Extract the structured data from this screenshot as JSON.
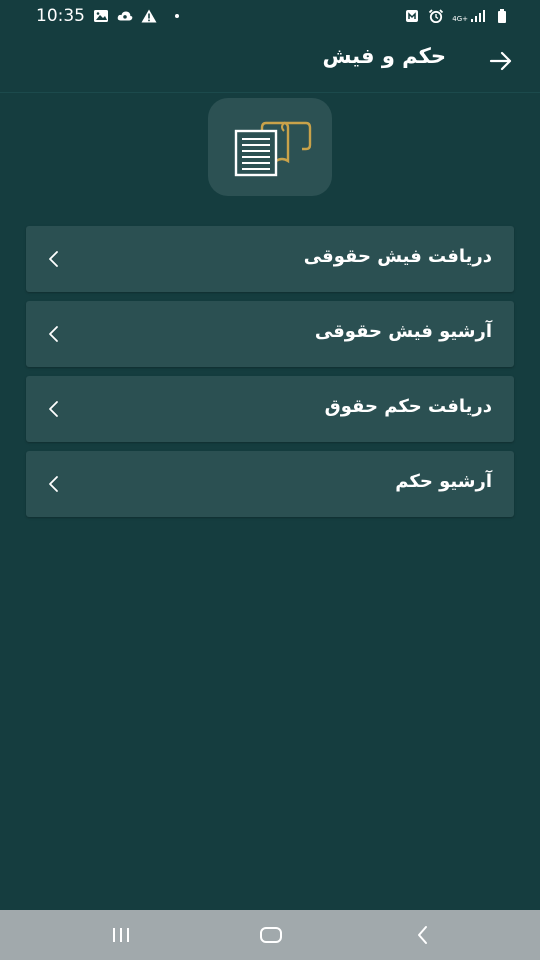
{
  "status_bar": {
    "time": "10:35",
    "network_label": "4G+"
  },
  "header": {
    "title": "حکم و فیش"
  },
  "menu": {
    "items": [
      {
        "label": "دریافت فیش حقوقی"
      },
      {
        "label": "آرشیو فیش حقوقی"
      },
      {
        "label": "دریافت حکم حقوق"
      },
      {
        "label": "آرشیو حکم"
      }
    ]
  },
  "colors": {
    "background": "#153d3f",
    "card": "#2b5052",
    "icon_tile": "#2c5153",
    "icon_accent": "#c9a24a",
    "nav_bar": "#a1a9ac"
  },
  "icons": {
    "back": "arrow-right-icon",
    "menu_item": "chevron-left-icon",
    "app": "documents-icon"
  }
}
